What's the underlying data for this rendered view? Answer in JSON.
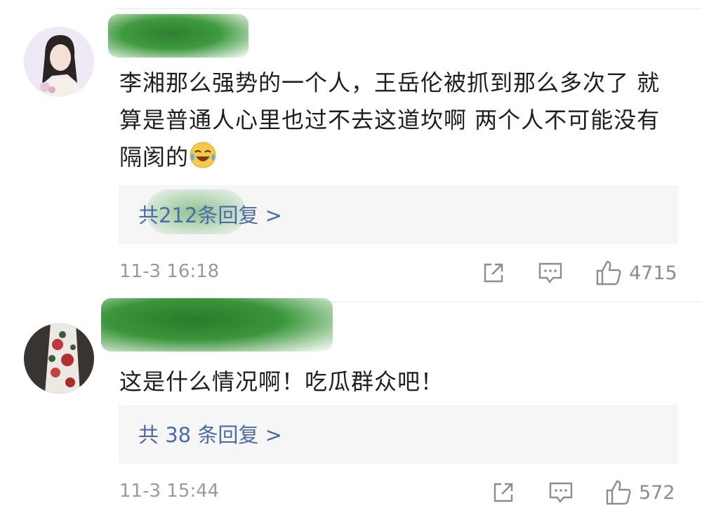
{
  "comments": [
    {
      "text": "李湘那么强势的一个人，王岳伦被抓到那么多次了 就算是普通人心里也过不去这道坎啊 两个人不可能没有隔阂的",
      "emoji": "laughing-crying-emoji",
      "reply_prefix": "共",
      "reply_count": "212",
      "reply_suffix": "条回复 >",
      "time": "11-3 16:18",
      "like_count": "4715"
    },
    {
      "text": "这是什么情况啊！吃瓜群众吧！",
      "reply_prefix": "共",
      "reply_count": "38",
      "reply_suffix": "条回复 >",
      "time": "11-3 15:44",
      "like_count": "572"
    }
  ],
  "colors": {
    "link": "#4d6aa8",
    "meta": "#9a9a9a",
    "reply_bg": "#f6f6f6"
  },
  "icons": [
    "share-icon",
    "comment-icon",
    "thumbs-up-icon"
  ]
}
